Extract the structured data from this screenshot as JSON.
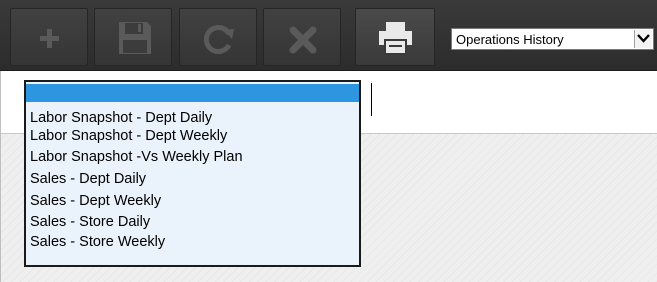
{
  "toolbar": {
    "buttons": [
      {
        "name": "add",
        "icon": "plus-icon"
      },
      {
        "name": "save",
        "icon": "floppy-disk-icon"
      },
      {
        "name": "refresh",
        "icon": "refresh-icon"
      },
      {
        "name": "delete",
        "icon": "x-icon"
      },
      {
        "name": "print",
        "icon": "printer-icon"
      }
    ],
    "view_select": {
      "value": "Operations History",
      "icon": "chevron-down-icon"
    }
  },
  "report_dropdown": {
    "selected_index": 0,
    "items": [
      {
        "label": ""
      },
      {
        "label": "Labor Snapshot - Dept Daily"
      },
      {
        "label": "Labor Snapshot - Dept Weekly"
      },
      {
        "label": "Labor Snapshot -Vs Weekly Plan"
      },
      {
        "label": "Sales - Dept Daily"
      },
      {
        "label": "Sales - Dept Weekly"
      },
      {
        "label": "Sales - Store Daily"
      },
      {
        "label": "Sales - Store Weekly"
      }
    ]
  },
  "colors": {
    "toolbar_bg": "#333333",
    "icon_dim": "#5a5a5a",
    "icon_active": "#e9e9e9",
    "selection": "#2e95e0",
    "list_bg": "#eaf2fb"
  }
}
